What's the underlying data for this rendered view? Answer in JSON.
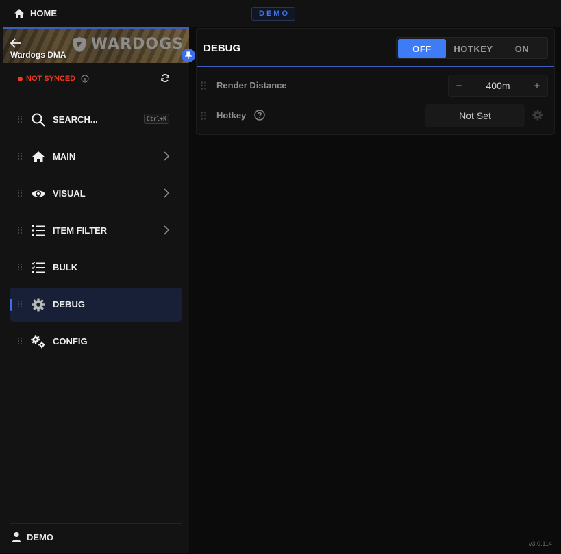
{
  "topbar": {
    "home_label": "HOME",
    "demo_badge": "DEMO"
  },
  "sidebar": {
    "banner_title": "Wardogs DMA",
    "brand_text": "WARDOGS",
    "sync_status": "NOT SYNCED",
    "items": [
      {
        "label": "SEARCH...",
        "shortcut": "Ctrl+K",
        "icon": "search-icon"
      },
      {
        "label": "MAIN",
        "icon": "home-icon",
        "submenu": true
      },
      {
        "label": "VISUAL",
        "icon": "eye-icon",
        "submenu": true
      },
      {
        "label": "ITEM FILTER",
        "icon": "list-icon",
        "submenu": true
      },
      {
        "label": "BULK",
        "icon": "checklist-icon"
      },
      {
        "label": "DEBUG",
        "icon": "gear-icon",
        "active": true
      },
      {
        "label": "CONFIG",
        "icon": "gears-icon"
      }
    ],
    "user_label": "DEMO"
  },
  "panel": {
    "title": "DEBUG",
    "modes": [
      "OFF",
      "HOTKEY",
      "ON"
    ],
    "selected_mode": "OFF",
    "render_distance": {
      "label": "Render Distance",
      "value": "400m"
    },
    "hotkey": {
      "label": "Hotkey",
      "value": "Not Set"
    }
  },
  "version": "v3.0.114",
  "colors": {
    "accent": "#3d7cf5",
    "warning": "#ee3a22",
    "background": "#0b0b0b",
    "sidebar": "#131313"
  }
}
